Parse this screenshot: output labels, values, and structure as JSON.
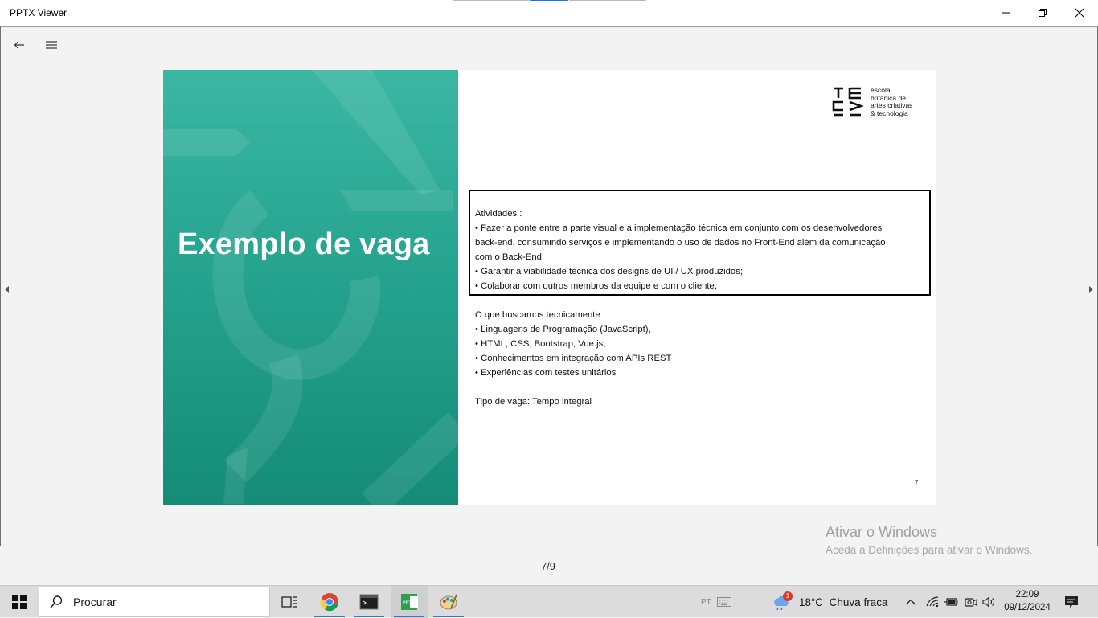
{
  "window": {
    "title": "PPTX Viewer"
  },
  "slide": {
    "heading": "Exemplo de vaga",
    "logo_lines": [
      "escola",
      "britânica de",
      "artes criativas",
      "& tecnologia"
    ],
    "activities_title": "Atividades :",
    "activities": [
      "• Fazer a ponte entre a parte visual e a implementação técnica em conjunto com os desenvolvedores",
      "back-end, consumindo serviços e implementando o uso de dados no Front-End além da comunicação",
      "com o Back-End.",
      "• Garantir a viabilidade técnica dos designs de UI / UX produzidos;",
      "• Colaborar com outros membros da equipe e com o cliente;"
    ],
    "tech_title": "O que buscamos tecnicamente :",
    "tech": [
      "• Linguagens de Programação (JavaScript),",
      "• HTML, CSS, Bootstrap, Vue.js;",
      "• Conhecimentos em integração com APIs REST",
      "• Experiências com testes unitários"
    ],
    "job_type": "Tipo de vaga: Tempo integral",
    "page_number": "7"
  },
  "pager": {
    "current": 7,
    "total": 9,
    "label": "7/9"
  },
  "watermark": {
    "line1": "Ativar o Windows",
    "line2": "Aceda a Definições para ativar o Windows."
  },
  "taskbar": {
    "search_placeholder": "Procurar",
    "lang": "PT",
    "weather_badge": "1",
    "weather": "18°C  Chuva fraca",
    "time": "22:09",
    "date": "09/12/2024"
  },
  "colors": {
    "slide_green_top": "#3bb7a3",
    "slide_green_bottom": "#148c77",
    "accent": "#2b7bd3"
  }
}
